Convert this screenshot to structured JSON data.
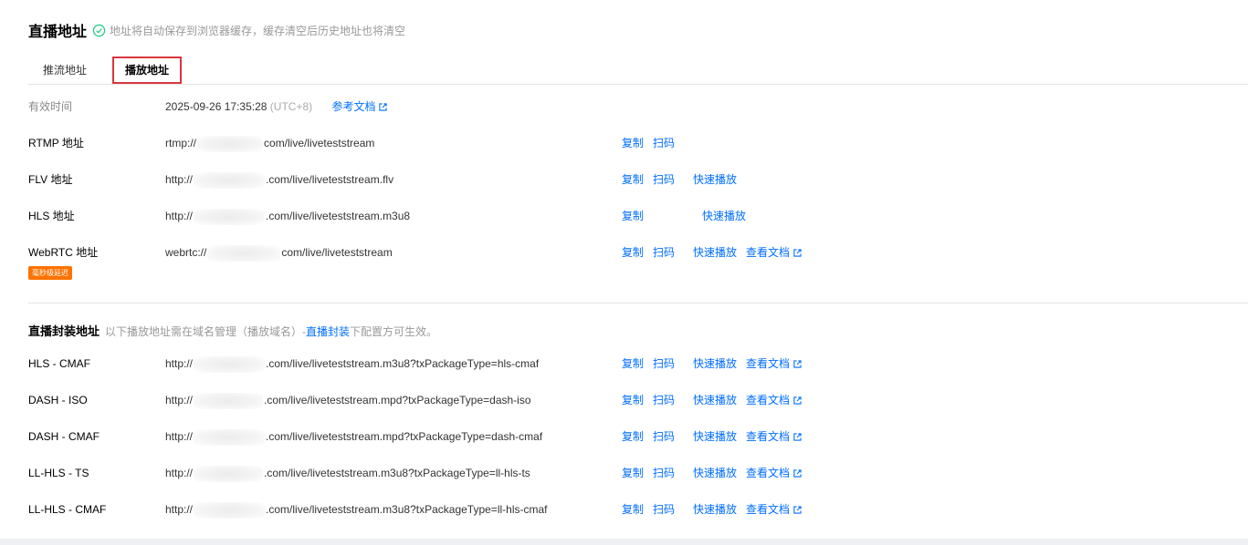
{
  "header": {
    "title": "直播地址",
    "tip": "地址将自动保存到浏览器缓存，缓存清空后历史地址也将清空"
  },
  "tabs": [
    {
      "label": "推流地址",
      "active": false
    },
    {
      "label": "播放地址",
      "active": true
    }
  ],
  "validity": {
    "label": "有效时间",
    "time": "2025-09-26 17:35:28",
    "tz": "(UTC+8)",
    "ref_doc": "参考文档"
  },
  "actions": {
    "copy": "复制",
    "scan": "扫码",
    "quick_play": "快速播放",
    "view_doc": "查看文档"
  },
  "play_rows": [
    {
      "label": "RTMP 地址",
      "prefix": "rtmp://",
      "suffix": "com/live/liveteststream"
    },
    {
      "label": "FLV 地址",
      "prefix": "http://",
      "suffix": ".com/live/liveteststream.flv"
    },
    {
      "label": "HLS 地址",
      "prefix": "http://",
      "suffix": ".com/live/liveteststream.m3u8"
    },
    {
      "label": "WebRTC 地址",
      "prefix": "webrtc://",
      "suffix": "com/live/liveteststream",
      "badge": "毫秒级延迟"
    }
  ],
  "package_section": {
    "title": "直播封装地址",
    "tip_before": "以下播放地址需在域名管理（播放域名）-",
    "link": "直播封装",
    "tip_after": "下配置方可生效。"
  },
  "package_rows": [
    {
      "label": "HLS - CMAF",
      "prefix": "http://",
      "suffix": ".com/live/liveteststream.m3u8?txPackageType=hls-cmaf"
    },
    {
      "label": "DASH - ISO",
      "prefix": "http://",
      "suffix": ".com/live/liveteststream.mpd?txPackageType=dash-iso"
    },
    {
      "label": "DASH - CMAF",
      "prefix": "http://",
      "suffix": ".com/live/liveteststream.mpd?txPackageType=dash-cmaf"
    },
    {
      "label": "LL-HLS - TS",
      "prefix": "http://",
      "suffix": ".com/live/liveteststream.m3u8?txPackageType=ll-hls-ts"
    },
    {
      "label": "LL-HLS - CMAF",
      "prefix": "http://",
      "suffix": ".com/live/liveteststream.m3u8?txPackageType=ll-hls-cmaf"
    }
  ],
  "colors": {
    "link": "#006eff",
    "success": "#29cc85",
    "badge": "#ff7200",
    "active_tab_border": "#d9363e"
  }
}
